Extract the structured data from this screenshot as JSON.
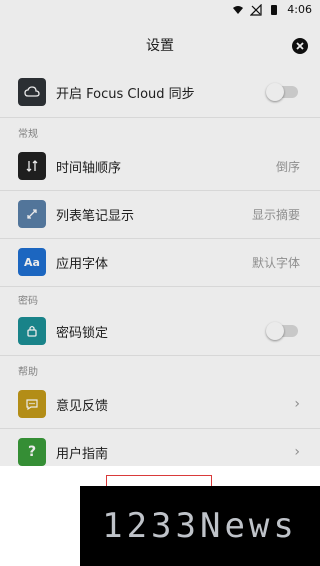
{
  "status": {
    "time": "4:06"
  },
  "settings": {
    "title": "设置",
    "sync_label": "开启 Focus Cloud 同步",
    "sections": {
      "general": "常规",
      "password": "密码",
      "help": "帮助"
    },
    "items": [
      {
        "label": "时间轴顺序",
        "value": "倒序"
      },
      {
        "label": "列表笔记显示",
        "value": "显示摘要"
      },
      {
        "label": "应用字体",
        "value": "默认字体"
      },
      {
        "label": "密码锁定",
        "value": ""
      },
      {
        "label": "意见反馈",
        "value": ""
      },
      {
        "label": "用户指南",
        "value": ""
      }
    ],
    "font_icon_text": "Aa"
  },
  "watermark": "1233News",
  "icons": {
    "cloud": "cloud-icon",
    "order": "timeline-order-icon",
    "list": "list-display-icon",
    "font": "font-icon",
    "lock": "lock-icon",
    "feedback": "feedback-icon",
    "guide": "guide-icon",
    "close": "close-icon"
  },
  "colors": {
    "cloud_icon_bg": "#2f3338",
    "order_icon_bg": "#222222",
    "list_icon_bg": "#5a7fa8",
    "font_icon_bg": "#1f6fd1",
    "lock_icon_bg": "#1c8f95",
    "feedback_icon_bg": "#c39a19",
    "guide_icon_bg": "#3a9b3a"
  }
}
